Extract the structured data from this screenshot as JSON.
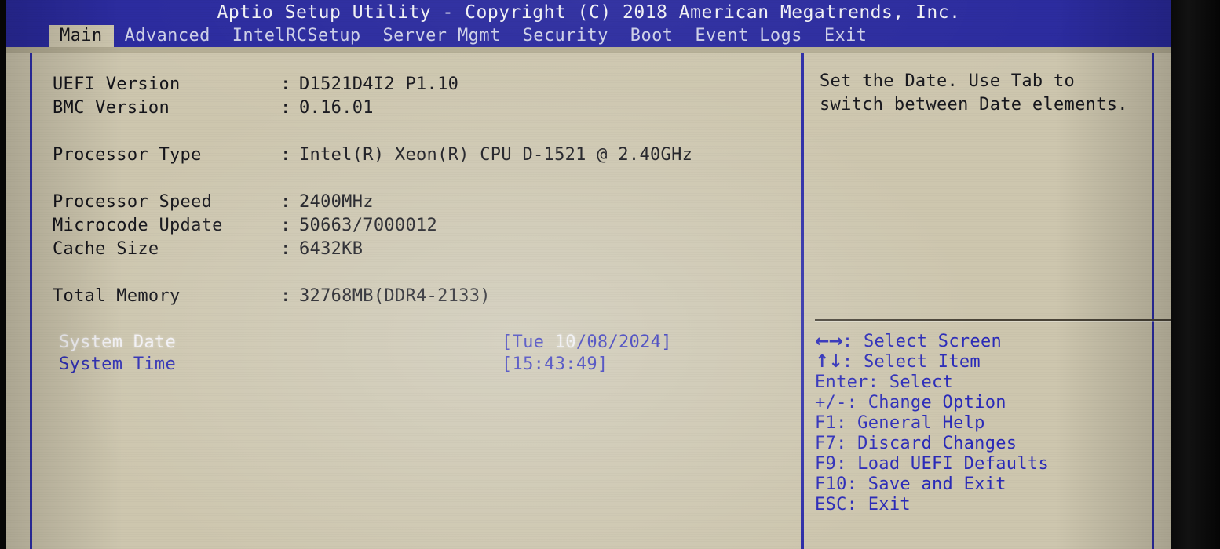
{
  "header": {
    "title": "Aptio Setup Utility - Copyright (C) 2018 American Megatrends, Inc."
  },
  "menu": {
    "tabs": [
      {
        "label": "Main",
        "active": true
      },
      {
        "label": "Advanced",
        "active": false
      },
      {
        "label": "IntelRCSetup",
        "active": false
      },
      {
        "label": "Server Mgmt",
        "active": false
      },
      {
        "label": "Security",
        "active": false
      },
      {
        "label": "Boot",
        "active": false
      },
      {
        "label": "Event Logs",
        "active": false
      },
      {
        "label": "Exit",
        "active": false
      }
    ]
  },
  "main": {
    "info_rows": [
      {
        "label": "UEFI Version",
        "colon": ":",
        "value": "D1521D4I2 P1.10"
      },
      {
        "label": "BMC Version",
        "colon": ":",
        "value": "0.16.01"
      },
      {
        "label": "Processor Type",
        "colon": ":",
        "value": "Intel(R) Xeon(R) CPU D-1521 @ 2.40GHz"
      },
      {
        "label": "Processor Speed",
        "colon": ":",
        "value": "2400MHz"
      },
      {
        "label": "Microcode Update",
        "colon": ":",
        "value": "50663/7000012"
      },
      {
        "label": "Cache Size",
        "colon": ":",
        "value": "6432KB"
      },
      {
        "label": "Total Memory",
        "colon": ":",
        "value": "32768MB(DDR4-2133)"
      }
    ],
    "system_date": {
      "label": "System Date",
      "value_prefix": "[Tue ",
      "value_highlight": "10",
      "value_suffix": "/08/2024]",
      "selected": true
    },
    "system_time": {
      "label": "System Time",
      "value": "[15:43:49]",
      "selected": false
    }
  },
  "help": {
    "text": "Set the Date. Use Tab to switch between Date elements.",
    "keys": [
      {
        "glyph": "←→",
        "text": ": Select Screen"
      },
      {
        "glyph": "↑↓",
        "text": ": Select Item"
      },
      {
        "glyph": "",
        "text": "Enter: Select"
      },
      {
        "glyph": "",
        "text": "+/-: Change Option"
      },
      {
        "glyph": "",
        "text": "F1: General Help"
      },
      {
        "glyph": "",
        "text": "F7: Discard Changes"
      },
      {
        "glyph": "",
        "text": "F9: Load UEFI Defaults"
      },
      {
        "glyph": "",
        "text": "F10: Save and Exit"
      },
      {
        "glyph": "",
        "text": "ESC: Exit"
      }
    ]
  },
  "colors": {
    "title_bar": "#2a2a9e",
    "panel_bg": "#cdc6ae",
    "border_blue": "#2d2da8",
    "text_dark": "#14141a",
    "text_blue": "#2a2ab8",
    "text_highlight": "#f4f3f7"
  }
}
